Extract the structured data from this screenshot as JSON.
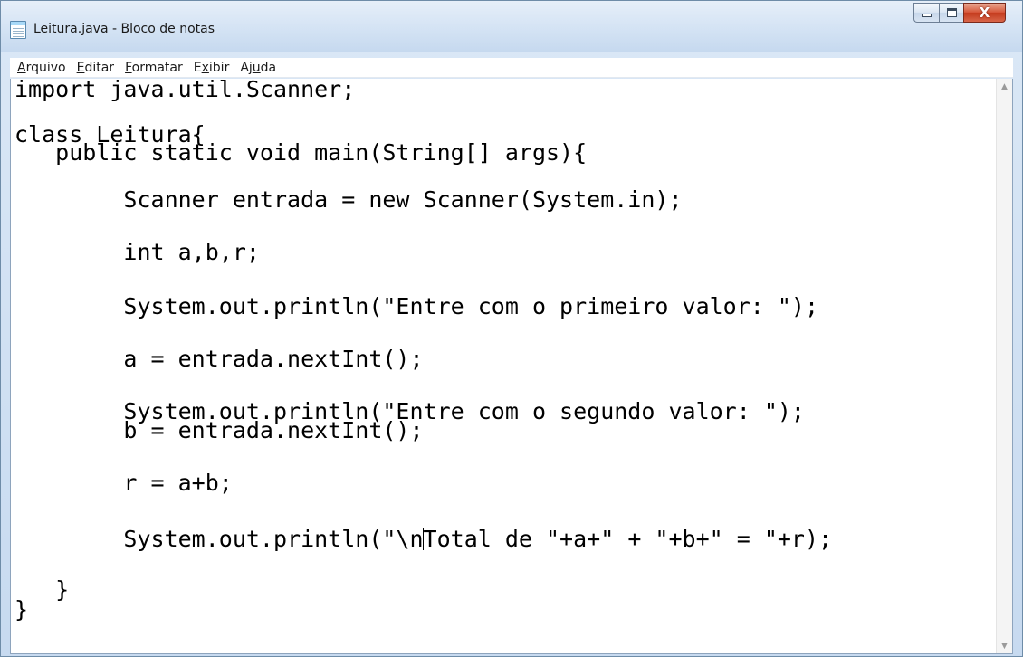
{
  "window": {
    "title": "Leitura.java - Bloco de notas",
    "icon": "notepad-icon"
  },
  "caption_buttons": {
    "minimize": "minimize-icon",
    "maximize": "maximize-icon",
    "close": "close-icon",
    "close_glyph": "X"
  },
  "menu": [
    {
      "label": "Arquivo",
      "accel": "A",
      "rest": "rquivo"
    },
    {
      "label": "Editar",
      "accel": "E",
      "rest": "ditar"
    },
    {
      "label": "Formatar",
      "accel": "F",
      "rest": "ormatar"
    },
    {
      "label": "Exibir",
      "pre": "E",
      "accel": "x",
      "rest": "ibir"
    },
    {
      "label": "Ajuda",
      "pre": "Aj",
      "accel": "u",
      "rest": "da"
    }
  ],
  "editor": {
    "lines": [
      "import java.util.Scanner;",
      "",
      "class Leitura{",
      "   public static void main(String[] args){",
      "",
      "        Scanner entrada = new Scanner(System.in);",
      "",
      "        int a,b,r;",
      "",
      "        System.out.println(\"Entre com o primeiro valor: \");",
      "",
      "        a = entrada.nextInt();",
      "",
      "        System.out.println(\"Entre com o segundo valor: \");",
      "        b = entrada.nextInt();",
      "",
      "        r = a+b;",
      "",
      "        System.out.println(\"\\nTotal de \"+a+\" + \"+b+\" = \"+r);",
      "",
      "   }",
      "}"
    ],
    "caret": {
      "line": 18,
      "after_text": "        System.out.println(\"\\n",
      "before_text": "Total de \"+a+\" + \"+b+\" = \"+r);"
    }
  },
  "scrollbar": {
    "up": "scroll-up-arrow-icon",
    "down": "scroll-down-arrow-icon"
  }
}
